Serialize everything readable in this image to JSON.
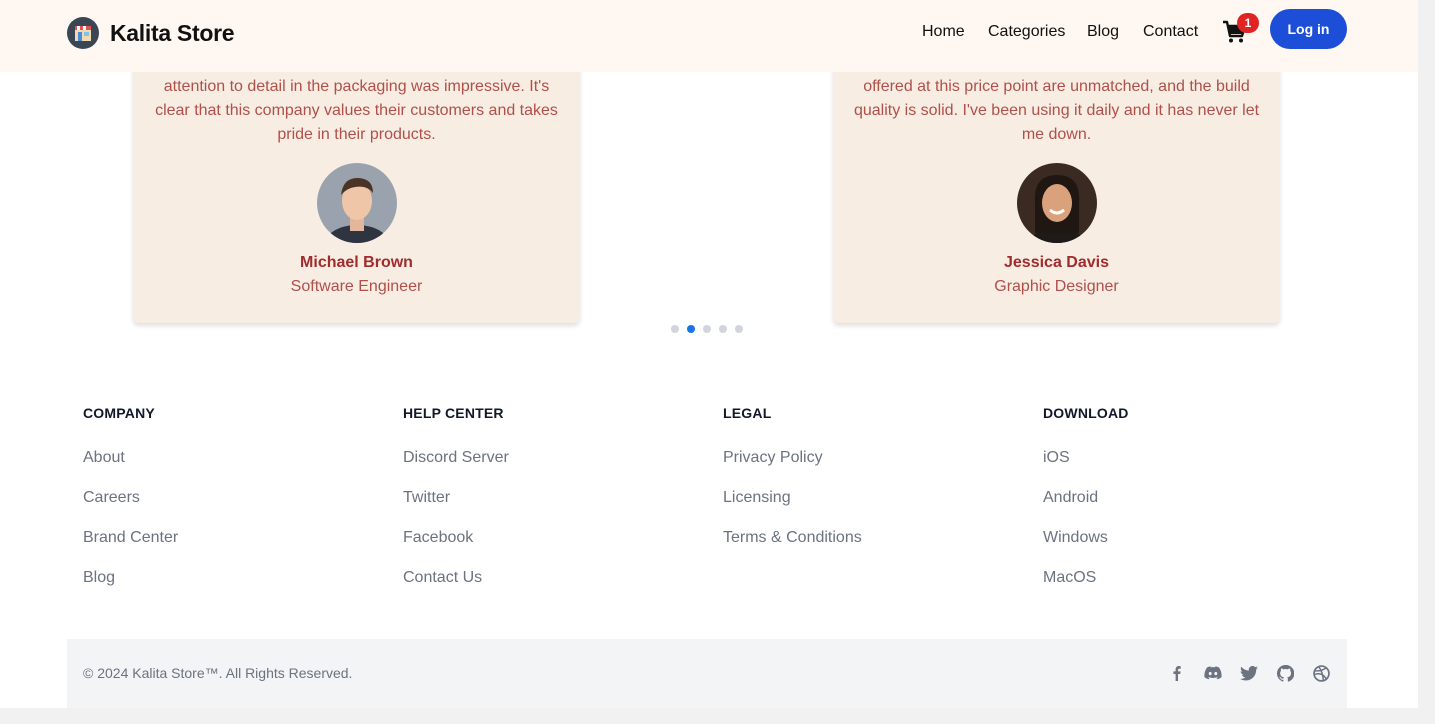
{
  "header": {
    "brand": "Kalita Store",
    "nav": [
      "Home",
      "Categories",
      "Blog",
      "Contact"
    ],
    "cart_count": "1",
    "login_label": "Log in"
  },
  "testimonials": [
    {
      "quote": "attention to detail in the packaging was impressive. It's clear that this company values their customers and takes pride in their products.",
      "name": "Michael Brown",
      "role": "Software Engineer"
    },
    {
      "quote": "offered at this price point are unmatched, and the build quality is solid. I've been using it daily and it has never let me down.",
      "name": "Jessica Davis",
      "role": "Graphic Designer"
    }
  ],
  "carousel": {
    "slides": 5,
    "active_index": 1
  },
  "footer": {
    "columns": [
      {
        "title": "COMPANY",
        "links": [
          "About",
          "Careers",
          "Brand Center",
          "Blog"
        ]
      },
      {
        "title": "HELP CENTER",
        "links": [
          "Discord Server",
          "Twitter",
          "Facebook",
          "Contact Us"
        ]
      },
      {
        "title": "LEGAL",
        "links": [
          "Privacy Policy",
          "Licensing",
          "Terms & Conditions"
        ]
      },
      {
        "title": "DOWNLOAD",
        "links": [
          "iOS",
          "Android",
          "Windows",
          "MacOS"
        ]
      }
    ],
    "copyright": "© 2024 Kalita Store™. All Rights Reserved.",
    "socials": [
      "facebook-icon",
      "discord-icon",
      "twitter-icon",
      "github-icon",
      "dribbble-icon"
    ]
  },
  "colors": {
    "header_bg": "#fff7f1",
    "card_bg": "#f8ede3",
    "accent": "#1d4ed8",
    "badge": "#e02424",
    "quote_text": "#b0504a",
    "name_text": "#a02c2c"
  }
}
